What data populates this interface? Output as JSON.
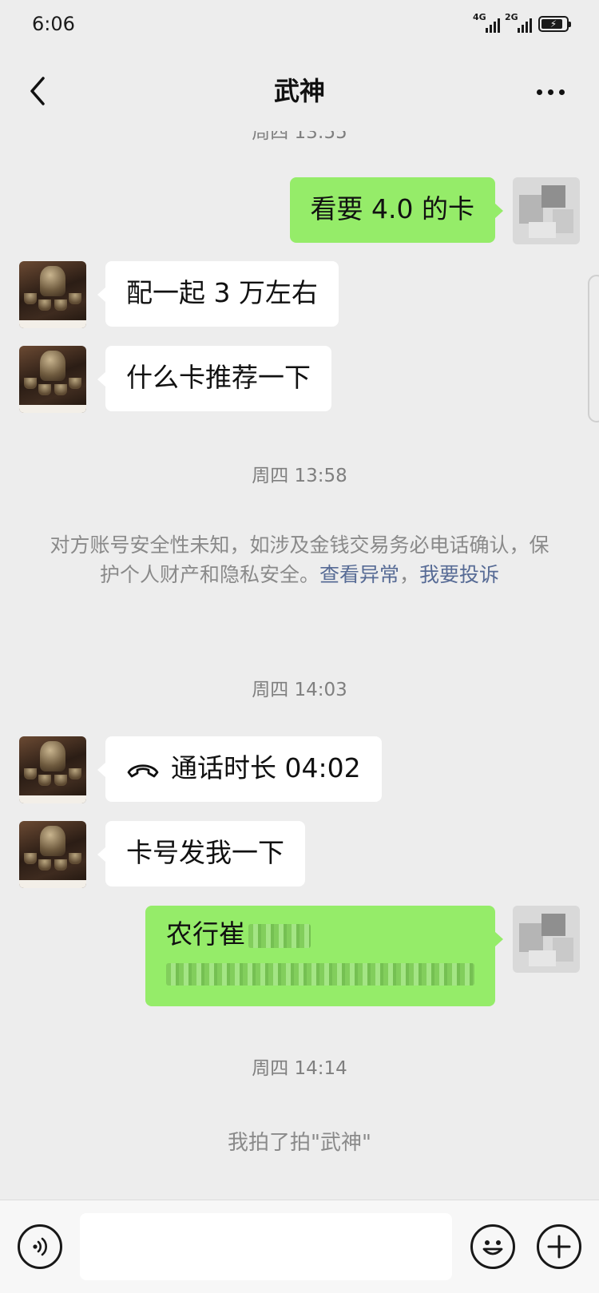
{
  "status_bar": {
    "time": "6:06",
    "net1": "4G",
    "net2": "2G"
  },
  "nav": {
    "title": "武神"
  },
  "timestamps": {
    "top_partial": "周四 13:55",
    "t1": "周四 13:58",
    "t2": "周四 14:03",
    "t3": "周四 14:14"
  },
  "messages": [
    {
      "side": "out",
      "text": "看要 4.0 的卡"
    },
    {
      "side": "in",
      "text": "配一起 3 万左右"
    },
    {
      "side": "in",
      "text": "什么卡推荐一下"
    },
    {
      "side": "in",
      "text": "通话时长 04:02",
      "type": "call"
    },
    {
      "side": "in",
      "text": "卡号发我一下"
    },
    {
      "side": "out",
      "text": "农行崔",
      "type": "card"
    }
  ],
  "notice": {
    "text": "对方账号安全性未知，如涉及金钱交易务必电话确认，保护个人财产和隐私安全。",
    "link1": "查看异常",
    "sep": "，",
    "link2": "我要投诉"
  },
  "system_message": "我拍了拍\"武神\"",
  "input": {
    "placeholder": ""
  },
  "icons": {
    "back": "chevron-left-icon",
    "more": "more-dots-icon",
    "voice": "voice-icon",
    "emoji": "emoji-icon",
    "plus": "plus-icon",
    "call": "phone-hangup-icon"
  },
  "colors": {
    "background": "#ededed",
    "outgoing_bubble": "#95ec69",
    "incoming_bubble": "#ffffff",
    "link": "#576b95",
    "timestamp": "#7f7f7f"
  }
}
